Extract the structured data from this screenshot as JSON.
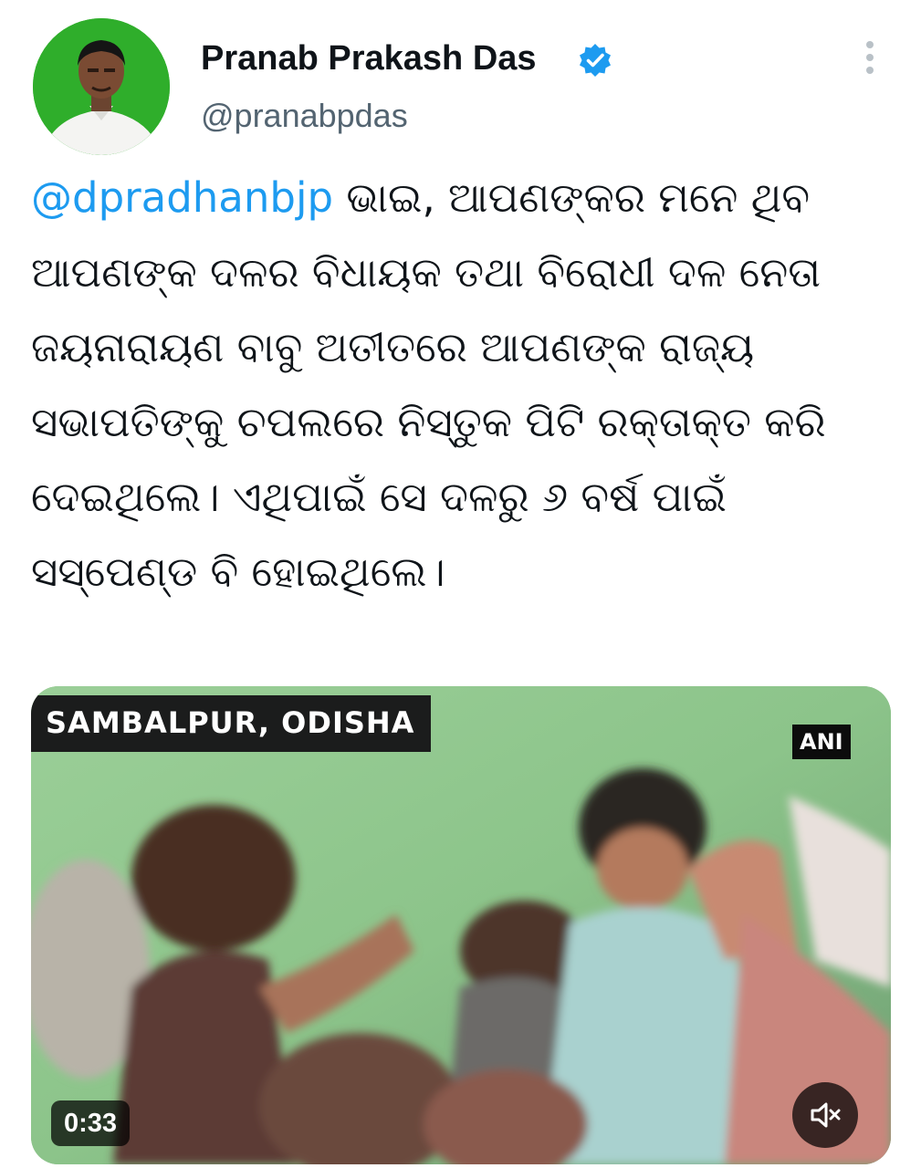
{
  "author": {
    "display_name": "Pranab Prakash Das",
    "handle": "@pranabpdas",
    "verified": true,
    "avatar_icon": "profile-photo",
    "avatar_bg_color": "#2fae2b"
  },
  "tweet": {
    "mention": "@dpradhanbjp",
    "body": " ଭାଇ, ଆପଣଙ୍କର ମନେ ଥିବ ଆପଣଙ୍କ ଦଳର ବିଧାୟକ ତଥା ବିରୋଧୀ ଦଳ ନେତା ଜୟନାରାୟଣ ବାବୁ ଅତୀତରେ ଆପଣଙ୍କ ରାଜ୍ୟ ସଭାପତିଙ୍କୁ ଚପଲରେ ନିସ୍ତୁକ ପିଟି ରକ୍ତାକ୍ତ କରି ଦେଇଥିଲେ। ଏଥିପାଇଁ ସେ ଦଳରୁ ୬ ବର୍ଷ ପାଇଁ ସସ୍‌ପେଣ୍ଡ ବି ହୋଇଥିଲେ।",
    "mention_color": "#1d9bf0"
  },
  "media": {
    "location_banner": "SAMBALPUR, ODISHA",
    "source_logo": "ANI",
    "duration": "0:33",
    "mute_icon": "volume-muted-icon"
  },
  "menu": {
    "more_icon": "more-options-icon"
  }
}
